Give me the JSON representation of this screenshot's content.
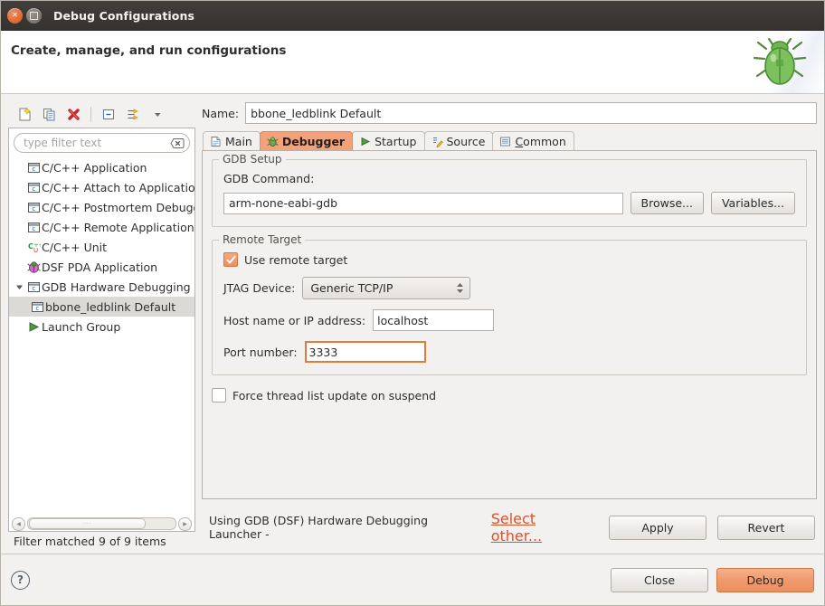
{
  "window": {
    "title": "Debug Configurations",
    "close_label": "x",
    "maximize_label": "maximize"
  },
  "header": {
    "title": "Create, manage, and run configurations",
    "art_icon": "green-bug-icon"
  },
  "toolbar": {
    "items": [
      {
        "name": "new-launch-configuration",
        "icon": "new-document-icon",
        "label": "New launch configuration"
      },
      {
        "name": "duplicate-launch-configuration",
        "icon": "duplicate-icon",
        "label": "Duplicate"
      },
      {
        "name": "delete-launch-configuration",
        "icon": "delete-red-x-icon",
        "label": "Delete"
      },
      {
        "name": "collapse-all",
        "icon": "collapse-all-icon",
        "label": "Collapse All"
      },
      {
        "name": "filter-launch-configurations",
        "icon": "filter-icon",
        "label": "Filter"
      },
      {
        "name": "view-menu",
        "icon": "chevron-down-icon",
        "label": "View Menu"
      }
    ]
  },
  "filter": {
    "placeholder": "type filter text",
    "value": "",
    "clear_icon": "clear-field-icon",
    "status": "Filter matched 9 of 9 items"
  },
  "tree": {
    "items": [
      {
        "label": "C/C++ Application",
        "icon": "c-launch-icon",
        "indent": 0,
        "expander": "",
        "selected": false
      },
      {
        "label": "C/C++ Attach to Application",
        "icon": "c-launch-icon",
        "indent": 0,
        "expander": "",
        "selected": false
      },
      {
        "label": "C/C++ Postmortem Debugger",
        "icon": "c-launch-icon",
        "indent": 0,
        "expander": "",
        "selected": false
      },
      {
        "label": "C/C++ Remote Application",
        "icon": "c-launch-icon",
        "indent": 0,
        "expander": "",
        "selected": false
      },
      {
        "label": "C/C++ Unit",
        "icon": "cunit-icon",
        "indent": 0,
        "expander": "",
        "selected": false
      },
      {
        "label": "DSF PDA Application",
        "icon": "pda-bug-icon",
        "indent": 0,
        "expander": "",
        "selected": false
      },
      {
        "label": "GDB Hardware Debugging",
        "icon": "c-launch-icon",
        "indent": 0,
        "expander": "expanded",
        "selected": false
      },
      {
        "label": "bbone_ledblink Default",
        "icon": "c-launch-icon",
        "indent": 1,
        "expander": "",
        "selected": true
      },
      {
        "label": "Launch Group",
        "icon": "green-play-icon",
        "indent": 0,
        "expander": "",
        "selected": false
      }
    ]
  },
  "config": {
    "name_label": "Name:",
    "name_value": "bbone_ledblink Default",
    "tabs": [
      {
        "label": "Main",
        "icon": "document-icon",
        "active": false
      },
      {
        "label": "Debugger",
        "icon": "debug-bug-icon",
        "active": true
      },
      {
        "label": "Startup",
        "icon": "green-play-icon",
        "active": false
      },
      {
        "label": "Source",
        "icon": "source-lookup-icon",
        "active": false
      },
      {
        "label": "Common",
        "icon": "common-icon",
        "active": false,
        "mnemonic": "C"
      }
    ]
  },
  "gdb_setup": {
    "legend": "GDB Setup",
    "command_label": "GDB Command:",
    "command_value": "arm-none-eabi-gdb",
    "browse_label": "Browse...",
    "variables_label": "Variables..."
  },
  "remote_target": {
    "legend": "Remote Target",
    "use_remote_label": "Use remote target",
    "use_remote_checked": true,
    "jtag_label": "JTAG Device:",
    "jtag_value": "Generic TCP/IP",
    "host_label": "Host name or IP address:",
    "host_value": "localhost",
    "port_label": "Port number:",
    "port_value": "3333"
  },
  "options": {
    "force_thread_label": "Force thread list update on suspend",
    "force_thread_checked": false
  },
  "launcher": {
    "text": "Using GDB (DSF) Hardware Debugging Launcher - ",
    "link_label": "Select other...",
    "apply_label": "Apply",
    "revert_label": "Revert"
  },
  "footer": {
    "help_label": "?",
    "close_label": "Close",
    "debug_label": "Debug"
  },
  "colors": {
    "accent_orange": "#f0996a",
    "tab_active": "#f4a17a",
    "link": "#d9532c",
    "titlebar": "#35322f",
    "panel_bg": "#f2f1f0",
    "focus_border": "#e07b3c"
  }
}
